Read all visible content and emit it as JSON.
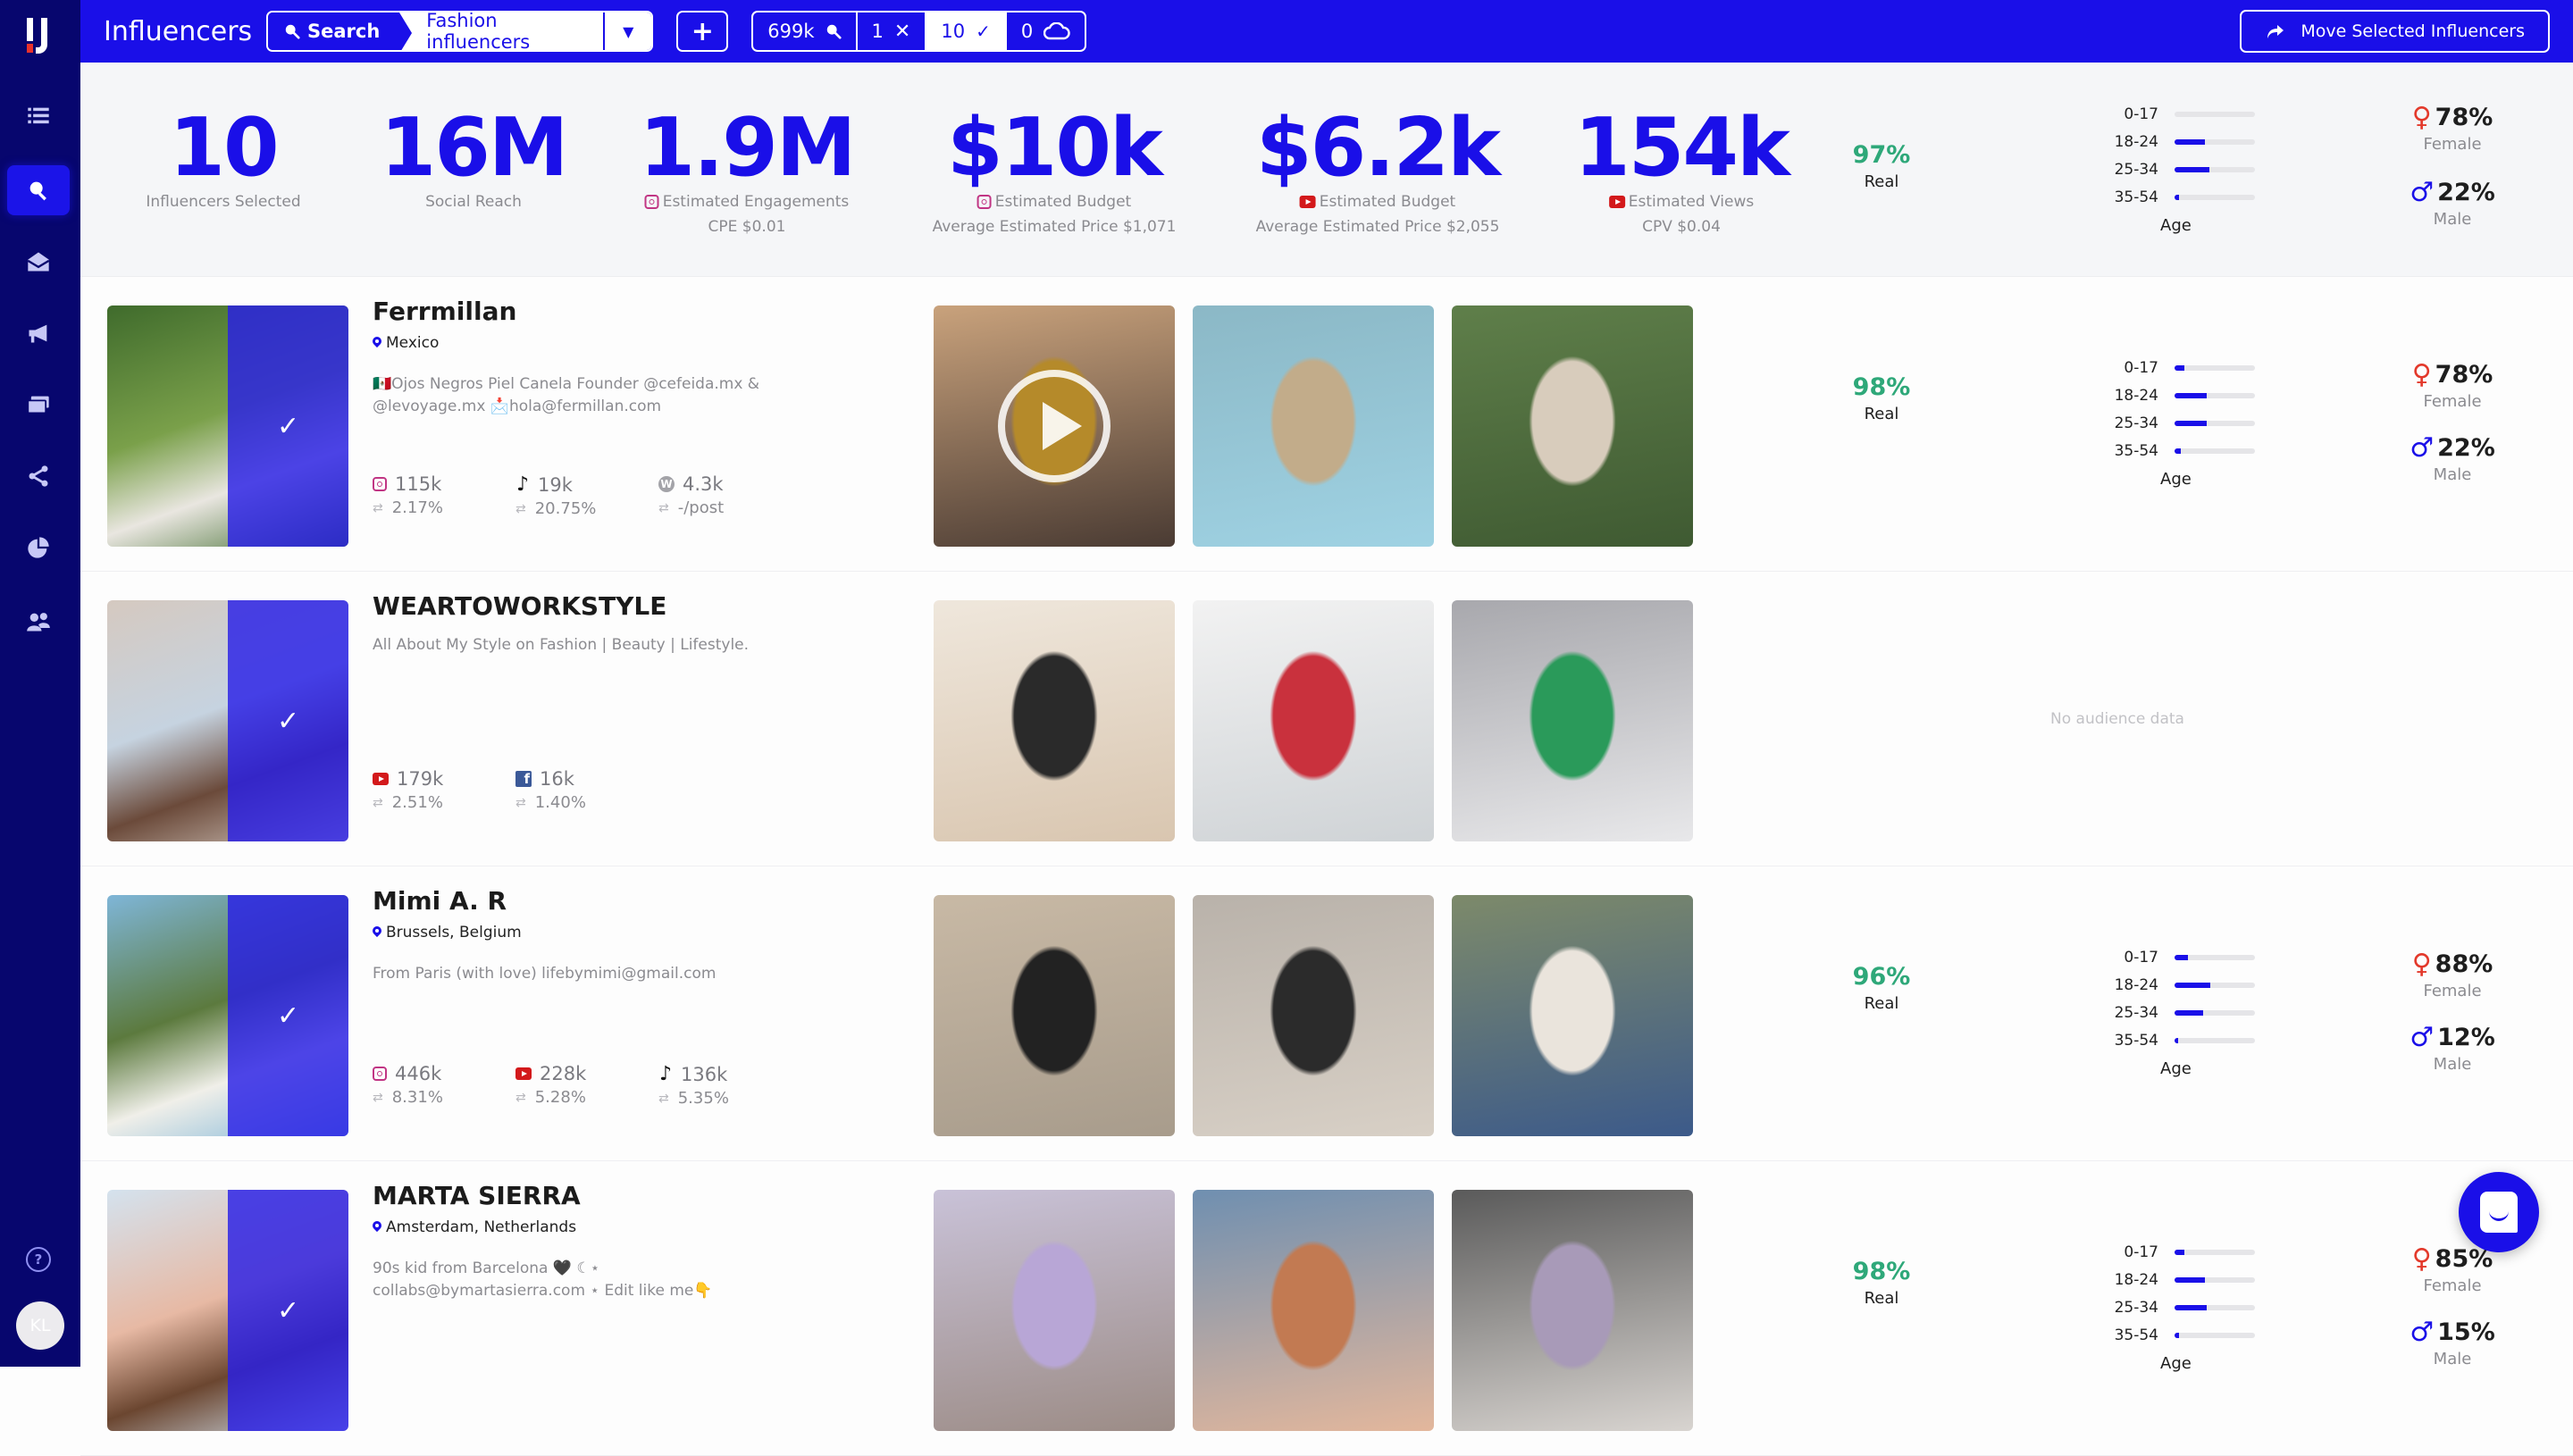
{
  "app": {
    "title": "Influencers"
  },
  "sidebar": {
    "items": [
      {
        "name": "lists",
        "icon": "list-icon",
        "active": false
      },
      {
        "name": "search",
        "icon": "search-icon",
        "active": true
      },
      {
        "name": "inbox",
        "icon": "envelope-open-icon",
        "active": false
      },
      {
        "name": "campaigns",
        "icon": "megaphone-icon",
        "active": false
      },
      {
        "name": "payments",
        "icon": "cards-icon",
        "active": false
      },
      {
        "name": "share",
        "icon": "share-icon",
        "active": false
      },
      {
        "name": "reports",
        "icon": "pie-chart-icon",
        "active": false
      },
      {
        "name": "team",
        "icon": "users-icon",
        "active": false
      }
    ],
    "help_label": "?",
    "avatar_initials": "KL"
  },
  "topbar": {
    "search_label": "Search",
    "search_value": "Fashion influencers",
    "add_label": "+",
    "counters": [
      {
        "value": "699k",
        "icon": "search-icon"
      },
      {
        "value": "1",
        "icon": "close-icon"
      },
      {
        "value": "10",
        "icon": "check-icon"
      },
      {
        "value": "0",
        "icon": "cloud-icon"
      }
    ],
    "move_label": "Move Selected Influencers"
  },
  "summary": {
    "stats": [
      {
        "value": "10",
        "label": "Influencers Selected",
        "sub": "",
        "platform": ""
      },
      {
        "value": "16M",
        "label": "Social Reach",
        "sub": "",
        "platform": ""
      },
      {
        "value": "1.9M",
        "label": "Estimated Engagements",
        "sub": "CPE $0.01",
        "platform": "instagram"
      },
      {
        "value": "$10k",
        "label": "Estimated Budget",
        "sub": "Average Estimated Price $1,071",
        "platform": "instagram"
      },
      {
        "value": "$6.2k",
        "label": "Estimated Budget",
        "sub": "Average Estimated Price $2,055",
        "platform": "youtube"
      },
      {
        "value": "154k",
        "label": "Estimated Views",
        "sub": "CPV $0.04",
        "platform": "youtube"
      }
    ],
    "real_pct": "97%",
    "real_label": "Real",
    "age_title": "Age",
    "ages": [
      {
        "label": "0-17",
        "pct": 0
      },
      {
        "label": "18-24",
        "pct": 38
      },
      {
        "label": "25-34",
        "pct": 43
      },
      {
        "label": "35-54",
        "pct": 6
      }
    ],
    "female_pct": "78%",
    "female_label": "Female",
    "male_pct": "22%",
    "male_label": "Male"
  },
  "influencers": [
    {
      "name": "Ferrmillan",
      "location": "Mexico",
      "bio": "🇲🇽Ojos Negros Piel Canela Founder @cefeida.mx & @levoyage.mx 📩hola@fermillan.com",
      "selected": true,
      "socials": [
        {
          "platform": "instagram",
          "followers": "115k",
          "engagement": "2.17%"
        },
        {
          "platform": "tiktok",
          "followers": "19k",
          "engagement": "20.75%"
        },
        {
          "platform": "wordpress",
          "followers": "4.3k",
          "engagement": "-/post"
        }
      ],
      "posts": [
        {
          "type": "video",
          "colors": [
            "#c9a27c",
            "#b58a2a",
            "#4a3b33"
          ]
        },
        {
          "type": "image",
          "colors": [
            "#8bb8c6",
            "#c2ac8a",
            "#9fd2e3"
          ]
        },
        {
          "type": "image",
          "colors": [
            "#5f7f4a",
            "#d8ccbc",
            "#3f5a32"
          ]
        }
      ],
      "audience": {
        "real_pct": "98%",
        "real_label": "Real",
        "age_title": "Age",
        "ages": [
          {
            "label": "0-17",
            "pct": 12
          },
          {
            "label": "18-24",
            "pct": 40
          },
          {
            "label": "25-34",
            "pct": 40
          },
          {
            "label": "35-54",
            "pct": 8
          }
        ],
        "female_pct": "78%",
        "female_label": "Female",
        "male_pct": "22%",
        "male_label": "Male"
      }
    },
    {
      "name": "WEARTOWORKSTYLE",
      "location": "",
      "bio": "All About My Style on Fashion | Beauty | Lifestyle.",
      "selected": true,
      "socials": [
        {
          "platform": "youtube",
          "followers": "179k",
          "engagement": "2.51%"
        },
        {
          "platform": "facebook",
          "followers": "16k",
          "engagement": "1.40%"
        }
      ],
      "posts": [
        {
          "type": "image",
          "colors": [
            "#efe7dc",
            "#2a2a2a",
            "#d9c6b0"
          ]
        },
        {
          "type": "image",
          "colors": [
            "#f2f2f2",
            "#c9313d",
            "#cfd3d6"
          ]
        },
        {
          "type": "image",
          "colors": [
            "#a8a8ad",
            "#2a9a5a",
            "#e8e8ea"
          ]
        }
      ],
      "no_audience": "No audience data"
    },
    {
      "name": "Mimi A. R",
      "location": "Brussels, Belgium",
      "bio": "From Paris (with love) lifebymimi@gmail.com",
      "selected": true,
      "socials": [
        {
          "platform": "instagram",
          "followers": "446k",
          "engagement": "8.31%"
        },
        {
          "platform": "youtube",
          "followers": "228k",
          "engagement": "5.28%"
        },
        {
          "platform": "tiktok",
          "followers": "136k",
          "engagement": "5.35%"
        }
      ],
      "posts": [
        {
          "type": "image",
          "colors": [
            "#c8b9a5",
            "#222222",
            "#a89c8c"
          ]
        },
        {
          "type": "image",
          "colors": [
            "#b9b2aa",
            "#2b2b2b",
            "#d8d0c6"
          ]
        },
        {
          "type": "image",
          "colors": [
            "#7d8a6a",
            "#eae4dc",
            "#3c5a8a"
          ]
        }
      ],
      "audience": {
        "real_pct": "96%",
        "real_label": "Real",
        "age_title": "Age",
        "ages": [
          {
            "label": "0-17",
            "pct": 17
          },
          {
            "label": "18-24",
            "pct": 44
          },
          {
            "label": "25-34",
            "pct": 35
          },
          {
            "label": "35-54",
            "pct": 4
          }
        ],
        "female_pct": "88%",
        "female_label": "Female",
        "male_pct": "12%",
        "male_label": "Male"
      }
    },
    {
      "name": "MARTA SIERRA",
      "location": "Amsterdam, Netherlands",
      "bio": "90s kid from Barcelona 🖤 ☾⋆ collabs@bymartasierra.com ⋆ Edit like me👇",
      "selected": true,
      "socials": [],
      "posts": [
        {
          "type": "image",
          "colors": [
            "#c9c2d8",
            "#b8a6d6",
            "#9c8c86"
          ]
        },
        {
          "type": "image",
          "colors": [
            "#6f8fb0",
            "#c27a52",
            "#e3b79c"
          ]
        },
        {
          "type": "image",
          "colors": [
            "#5a5a5a",
            "#a89ab8",
            "#d8d4d0"
          ]
        }
      ],
      "audience": {
        "real_pct": "98%",
        "real_label": "Real",
        "age_title": "Age",
        "ages": [
          {
            "label": "0-17",
            "pct": 12
          },
          {
            "label": "18-24",
            "pct": 38
          },
          {
            "label": "25-34",
            "pct": 40
          },
          {
            "label": "35-54",
            "pct": 6
          }
        ],
        "female_pct": "85%",
        "female_label": "Female",
        "male_pct": "15%",
        "male_label": "Male"
      }
    }
  ],
  "avatar_colors": [
    [
      "#3f6b2c",
      "#e9e6e0",
      "#7aa04a"
    ],
    [
      "#d5c9c0",
      "#6b4a3a",
      "#c6d3e0"
    ],
    [
      "#7fb6d8",
      "#f0efe9",
      "#5c7a3e"
    ],
    [
      "#d4e2ee",
      "#6b4630",
      "#e7b9a4"
    ]
  ],
  "chat_icon": "chat-icon"
}
